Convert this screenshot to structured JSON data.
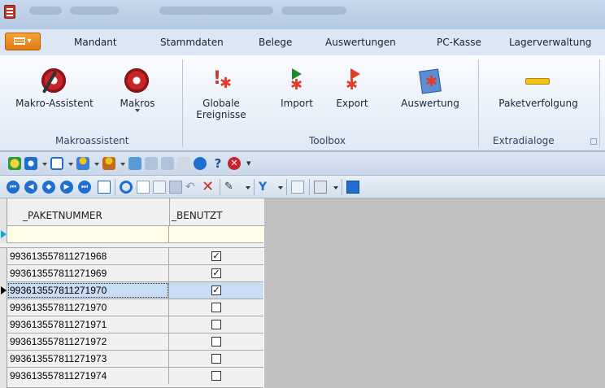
{
  "menu": {
    "tabs": [
      "Mandant",
      "Stammdaten",
      "Belege",
      "Auswertungen",
      "PC-Kasse",
      "Lagerverwaltung"
    ]
  },
  "ribbon": {
    "makro_assistent": "Makro-Assistent",
    "makros": "Makros",
    "globale_1": "Globale",
    "globale_2": "Ereignisse",
    "import": "Import",
    "export": "Export",
    "auswertung": "Auswertung",
    "paketverfolgung": "Paketverfolgung",
    "group_makro": "Makroassistent",
    "group_toolbox": "Toolbox",
    "group_extra": "Extradialoge"
  },
  "grid": {
    "col1": "_PAKETNUMMER",
    "col2": "_BENUTZT",
    "rows": [
      {
        "num": "993613557811271968",
        "used": true
      },
      {
        "num": "993613557811271969",
        "used": true
      },
      {
        "num": "993613557811271970",
        "used": true
      },
      {
        "num": "993613557811271970",
        "used": false
      },
      {
        "num": "993613557811271971",
        "used": false
      },
      {
        "num": "993613557811271972",
        "used": false
      },
      {
        "num": "993613557811271973",
        "used": false
      },
      {
        "num": "993613557811271974",
        "used": false
      }
    ]
  },
  "colors": {
    "accent": "#e07b10",
    "selection": "#c8dcf4",
    "nav": "#1e6fd1"
  }
}
